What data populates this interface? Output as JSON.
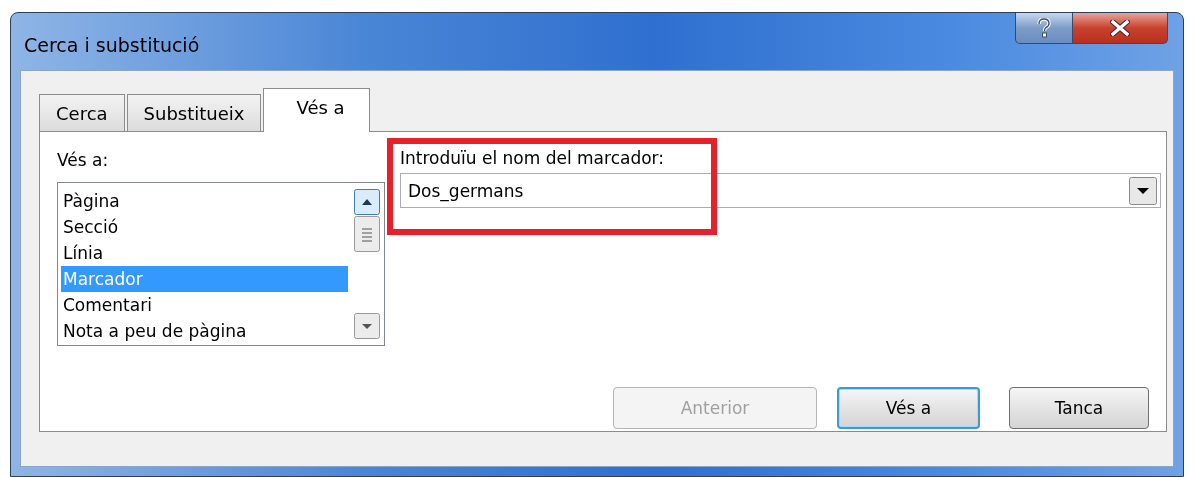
{
  "window": {
    "title": "Cerca i substitució"
  },
  "tabs": [
    {
      "label": "Cerca",
      "selected": false
    },
    {
      "label": "Substitueix",
      "selected": false
    },
    {
      "label": "Vés a",
      "selected": true
    }
  ],
  "goto_list": {
    "label": "Vés a:",
    "items": [
      {
        "label": "Pàgina",
        "selected": false
      },
      {
        "label": "Secció",
        "selected": false
      },
      {
        "label": "Línia",
        "selected": false
      },
      {
        "label": "Marcador",
        "selected": true
      },
      {
        "label": "Comentari",
        "selected": false
      },
      {
        "label": "Nota a peu de pàgina",
        "selected": false
      }
    ]
  },
  "bookmark_field": {
    "label": "Introduïu el nom del marcador:",
    "value": "Dos_germans"
  },
  "buttons": [
    {
      "label": "Anterior",
      "disabled": true,
      "default": false
    },
    {
      "label": "Vés a",
      "disabled": false,
      "default": true
    },
    {
      "label": "Tanca",
      "disabled": false,
      "default": false
    }
  ]
}
